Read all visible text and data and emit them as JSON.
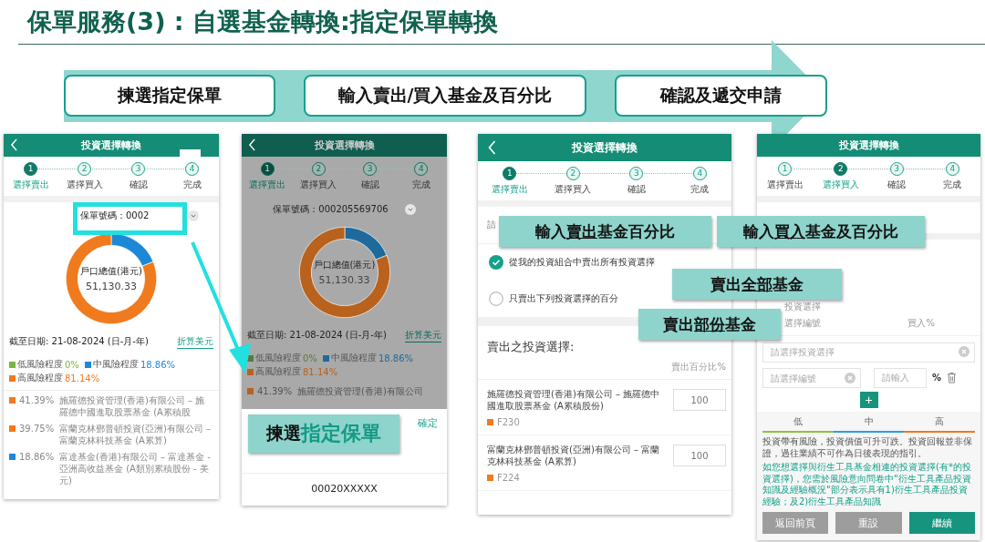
{
  "title": "保單服務(3) : 自選基金轉換:指定保單轉換",
  "process_steps": [
    "揀選指定保單",
    "輸入賣出/買入基金及百分比",
    "確認及遞交申請"
  ],
  "screen_1": {
    "title": "投資選擇轉換",
    "steps": [
      {
        "number": "1",
        "label": "選擇賣出",
        "selected": true
      },
      {
        "number": "2",
        "label": "選擇買入",
        "selected": false
      },
      {
        "number": "3",
        "label": "確認",
        "selected": false
      },
      {
        "number": "4",
        "label": "完成",
        "selected": false
      }
    ],
    "policy_label": "保單號碼：0002",
    "chart_data": {
      "type": "donut",
      "categories": [
        "低風險程度",
        "中風險程度",
        "高風險程度"
      ],
      "values": [
        0,
        18.86,
        81.14
      ]
    },
    "donut_caption": "戶口總值(港元)",
    "donut_value": "51,130.33",
    "as_of": "截至日期: 21-08-2024 (日-月-年)",
    "convert_link": "折算美元",
    "risk_legend": [
      {
        "value": "0%",
        "color": "#7cb342"
      },
      {
        "value": "18.86%",
        "color": "#1e88d8"
      },
      {
        "value": "81.14%",
        "color": "#f07a1e"
      }
    ],
    "holdings": [
      {
        "percent": "41.39%",
        "name": "施羅德投資管理(香港)有限公司 – 施羅德中國進取股票基金 (A累積股",
        "color": "#f07a1e"
      },
      {
        "percent": "39.75%",
        "name": "富蘭克林鄧普頓投資(亞洲)有限公司 – 富蘭克林科技基金 (A累算)",
        "color": "#f07a1e"
      },
      {
        "percent": "18.86%",
        "name": "富達基金(香港)有限公司 – 富達基金 - 亞洲高收益基金 (A類別累積股份 - 美元)",
        "color": "#1e88d8"
      }
    ]
  },
  "screen_2": {
    "title": "投資選擇轉換",
    "steps": [
      {
        "number": "1",
        "label": "選擇賣出",
        "selected": true
      },
      {
        "number": "2",
        "label": "選擇買入",
        "selected": false
      },
      {
        "number": "3",
        "label": "確認",
        "selected": false
      },
      {
        "number": "4",
        "label": "完成",
        "selected": false
      }
    ],
    "policy_label": "保單號碼：000205569706",
    "chart_data": {
      "type": "donut",
      "categories": [
        "低風險程度",
        "中風險程度",
        "高風險程度"
      ],
      "values": [
        0,
        18.86,
        81.14
      ]
    },
    "donut_caption": "戶口總值(港元)",
    "donut_value": "51,130.33",
    "as_of": "截至日期: 21-08-2024 (日-月-年)",
    "convert_link": "折算美元",
    "risk_legend": [
      {
        "value": "0%",
        "color": "#5a7a3c"
      },
      {
        "value": "18.86%",
        "color": "#1f6a9c"
      },
      {
        "value": "81.14%",
        "color": "#b8621e"
      }
    ],
    "holdings": [
      {
        "percent": "41.39%",
        "name": "施羅德投資管理(香港)有限公司",
        "color": "#b8621e"
      }
    ],
    "confirm": "確定",
    "option": "00020XXXXX",
    "callout": {
      "prefix": "揀選",
      "highlight": "指定保單"
    }
  },
  "screen_3": {
    "title": "投資選擇轉換",
    "steps": [
      {
        "number": "1",
        "label": "選擇賣出",
        "selected": true
      },
      {
        "number": "2",
        "label": "選擇買入",
        "selected": false
      },
      {
        "number": "3",
        "label": "確認",
        "selected": false
      },
      {
        "number": "4",
        "label": "完成",
        "selected": false
      }
    ],
    "instruction": "請",
    "options": [
      {
        "label": "從我的投資組合中賣出所有投資選擇",
        "selected": true
      },
      {
        "label": "只賣出下列投資選擇的百分",
        "selected": false
      }
    ],
    "section_title": "賣出之投資選擇:",
    "column_header": "賣出百分比%",
    "funds": [
      {
        "name": "施羅德投資管理(香港)有限公司 – 施羅德中國進取股票基金 (A累積股份)",
        "code": "F230",
        "value": "100",
        "color": "#f07a1e"
      },
      {
        "name": "富蘭克林鄧普頓投資(亞洲)有限公司 – 富蘭克林科技基金 (A累算)",
        "code": "F224",
        "value": "100",
        "color": "#f07a1e"
      }
    ]
  },
  "screen_4": {
    "title": "投資選擇轉換",
    "steps": [
      {
        "number": "1",
        "label": "選擇賣出",
        "selected": false
      },
      {
        "number": "2",
        "label": "選擇買入",
        "selected": true
      },
      {
        "number": "3",
        "label": "確認",
        "selected": false
      },
      {
        "number": "4",
        "label": "完成",
        "selected": false
      }
    ],
    "fund_label": "投資選擇",
    "columns": [
      "選擇編號",
      "買入%"
    ],
    "fund_placeholder": "請選擇投資選擇",
    "code_placeholder": "請選擇編號",
    "percent_placeholder": "請輸入",
    "percent_sign": "%",
    "add_button": "+",
    "risk_scale": [
      {
        "label": "低",
        "color": "#8bc34a"
      },
      {
        "label": "中",
        "color": "#2f9be0"
      },
      {
        "label": "高",
        "color": "#f07a1e"
      }
    ],
    "disclaimer": "投資帶有風險，投資價值可升可跌。投資回報並非保證，過往業績不可作為日後表現的指引。",
    "derivative_note": "如您想選擇與衍生工具基金相連的投資選擇(有*的投資選擇)，您需於風險意向問卷中\"衍生工具產品投資知識及經驗概況\"部分表示具有1)衍生工具產品投資經驗；及2)衍生工具產品知識",
    "buttons": [
      {
        "label": "返回前頁",
        "kind": "secondary"
      },
      {
        "label": "重設",
        "kind": "secondary"
      },
      {
        "label": "繼續",
        "kind": "primary"
      }
    ]
  },
  "callouts": [
    {
      "before": "輸入",
      "underlined": "賣出",
      "after": "基金百分比"
    },
    {
      "before": "輸入",
      "underlined": "買入",
      "after": "基金及百分比"
    },
    {
      "before": "賣出",
      "underlined": "全部",
      "after": "基金"
    },
    {
      "before": "賣出",
      "underlined": "部份",
      "after": "基金"
    }
  ]
}
